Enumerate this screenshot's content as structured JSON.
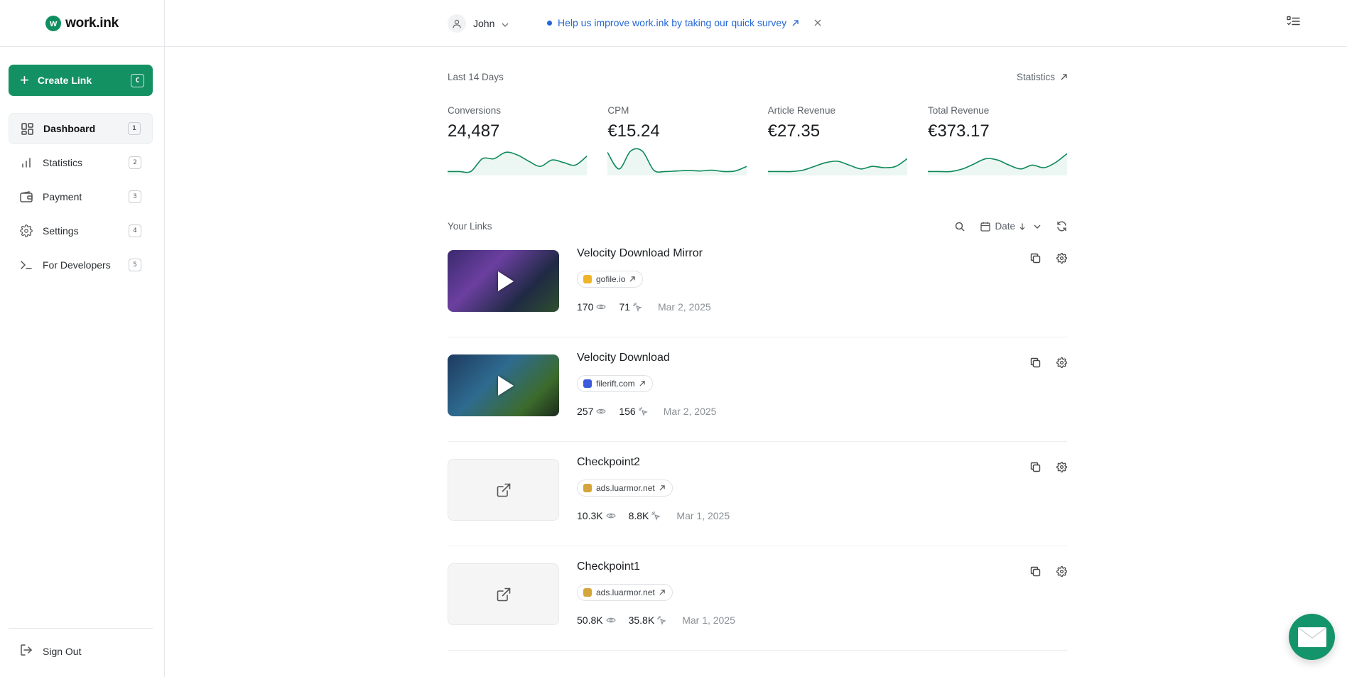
{
  "brand": {
    "logo_letter": "w",
    "name": "work.ink"
  },
  "sidebar": {
    "create_label": "Create Link",
    "create_shortcut": "C",
    "items": [
      {
        "label": "Dashboard",
        "shortcut": "1",
        "icon": "dashboard-icon"
      },
      {
        "label": "Statistics",
        "shortcut": "2",
        "icon": "bar-chart-icon"
      },
      {
        "label": "Payment",
        "shortcut": "3",
        "icon": "wallet-icon"
      },
      {
        "label": "Settings",
        "shortcut": "4",
        "icon": "gear-icon"
      },
      {
        "label": "For Developers",
        "shortcut": "5",
        "icon": "terminal-icon"
      }
    ],
    "signout_label": "Sign Out"
  },
  "topbar": {
    "user_name": "John",
    "survey_text": "Help us improve work.ink by taking our quick survey"
  },
  "overview": {
    "period_label": "Last 14 Days",
    "stats_link": "Statistics",
    "metrics": [
      {
        "label": "Conversions",
        "value": "24,487"
      },
      {
        "label": "CPM",
        "value": "€15.24"
      },
      {
        "label": "Article Revenue",
        "value": "€27.35"
      },
      {
        "label": "Total Revenue",
        "value": "€373.17"
      }
    ]
  },
  "chart_data": [
    {
      "type": "area",
      "title": "",
      "values": [
        0.1,
        0.1,
        0.1,
        0.6,
        0.6,
        0.85,
        0.75,
        0.5,
        0.3,
        0.55,
        0.45,
        0.35,
        0.7
      ]
    },
    {
      "type": "area",
      "title": "",
      "values": [
        0.85,
        0.2,
        0.9,
        0.9,
        0.15,
        0.1,
        0.12,
        0.14,
        0.12,
        0.15,
        0.1,
        0.12,
        0.3
      ]
    },
    {
      "type": "area",
      "title": "",
      "values": [
        0.1,
        0.1,
        0.1,
        0.15,
        0.3,
        0.45,
        0.5,
        0.35,
        0.2,
        0.3,
        0.25,
        0.3,
        0.6
      ]
    },
    {
      "type": "area",
      "title": "",
      "values": [
        0.1,
        0.1,
        0.1,
        0.2,
        0.4,
        0.6,
        0.55,
        0.35,
        0.2,
        0.35,
        0.25,
        0.45,
        0.8
      ]
    }
  ],
  "links": {
    "section_label": "Your Links",
    "sort_label": "Date",
    "items": [
      {
        "title": "Velocity Download Mirror",
        "domain": "gofile.io",
        "views": "170",
        "conversions": "71",
        "date": "Mar 2, 2025",
        "thumb": "video",
        "fav_color": "#f0b429"
      },
      {
        "title": "Velocity Download",
        "domain": "filerift.com",
        "views": "257",
        "conversions": "156",
        "date": "Mar 2, 2025",
        "thumb": "video2",
        "fav_color": "#3b5bdb"
      },
      {
        "title": "Checkpoint2",
        "domain": "ads.luarmor.net",
        "views": "10.3K",
        "conversions": "8.8K",
        "date": "Mar 1, 2025",
        "thumb": "empty",
        "fav_color": "#d4a53a"
      },
      {
        "title": "Checkpoint1",
        "domain": "ads.luarmor.net",
        "views": "50.8K",
        "conversions": "35.8K",
        "date": "Mar 1, 2025",
        "thumb": "empty",
        "fav_color": "#d4a53a"
      }
    ]
  },
  "colors": {
    "accent": "#149163",
    "link": "#2466d6",
    "spark": "#0f8a5a"
  }
}
